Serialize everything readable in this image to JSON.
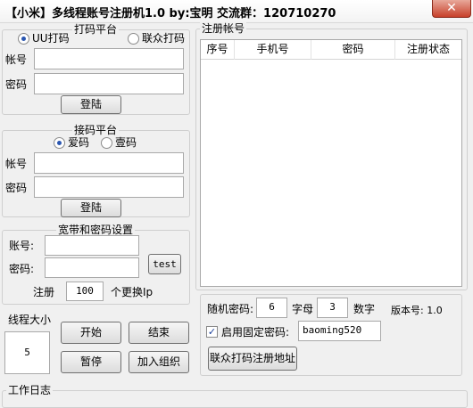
{
  "window": {
    "title": "【小米】多线程账号注册机1.0  by:宝明  交流群：120710270",
    "close_glyph": "✕"
  },
  "dama": {
    "legend": "打码平台",
    "options": [
      "UU打码",
      "联众打码"
    ],
    "selected": "UU打码",
    "account_label": "帐号",
    "password_label": "密码",
    "account_value": "",
    "password_value": "",
    "login_label": "登陆"
  },
  "jiema": {
    "legend": "接码平台",
    "options": [
      "爱码",
      "壹码"
    ],
    "selected": "爱码",
    "account_label": "帐号",
    "password_label": "密码",
    "account_value": "",
    "password_value": "",
    "login_label": "登陆"
  },
  "broadband": {
    "legend": "宽带和密码设置",
    "account_label": "账号:",
    "password_label": "密码:",
    "account_value": "",
    "password_value": "",
    "test_label": "test",
    "register_label": "注册",
    "register_count": "100",
    "change_ip_label": "个更换Ip"
  },
  "threads": {
    "legend": "线程大小",
    "value": "5"
  },
  "actions": {
    "start": "开始",
    "end": "结束",
    "pause": "暂停",
    "join_group": "加入组织"
  },
  "accounts": {
    "legend": "注册帐号",
    "columns": [
      "序号",
      "手机号",
      "密码",
      "注册状态"
    ],
    "rows": []
  },
  "settings": {
    "random_password_label": "随机密码:",
    "letters_count": "6",
    "letters_label": "字母",
    "digits_count": "3",
    "digits_label": "数字",
    "version_label": "版本号: 1.0",
    "fixed_password_checked": true,
    "fixed_password_label": "启用固定密码:",
    "fixed_password_value": "baoming520",
    "lianzhong_register_label": "联众打码注册地址"
  },
  "log": {
    "legend": "工作日志"
  },
  "icons": {
    "check": "✓"
  }
}
